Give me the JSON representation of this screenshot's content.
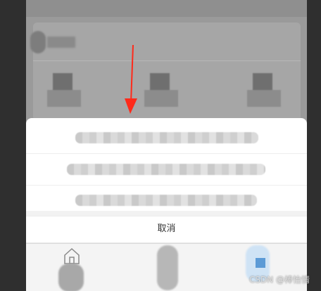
{
  "action_sheet": {
    "cancel_label": "取消"
  },
  "tabbar": {
    "tabs": [
      {
        "icon": "home-icon"
      },
      {
        "icon": "unknown-icon"
      },
      {
        "icon": "unknown-icon"
      }
    ]
  },
  "watermark": "CSDN @棒怡情",
  "colors": {
    "annotation_arrow": "#ff2a1a",
    "sheet_background": "#ffffff",
    "overlay": "#9a9a9a"
  }
}
